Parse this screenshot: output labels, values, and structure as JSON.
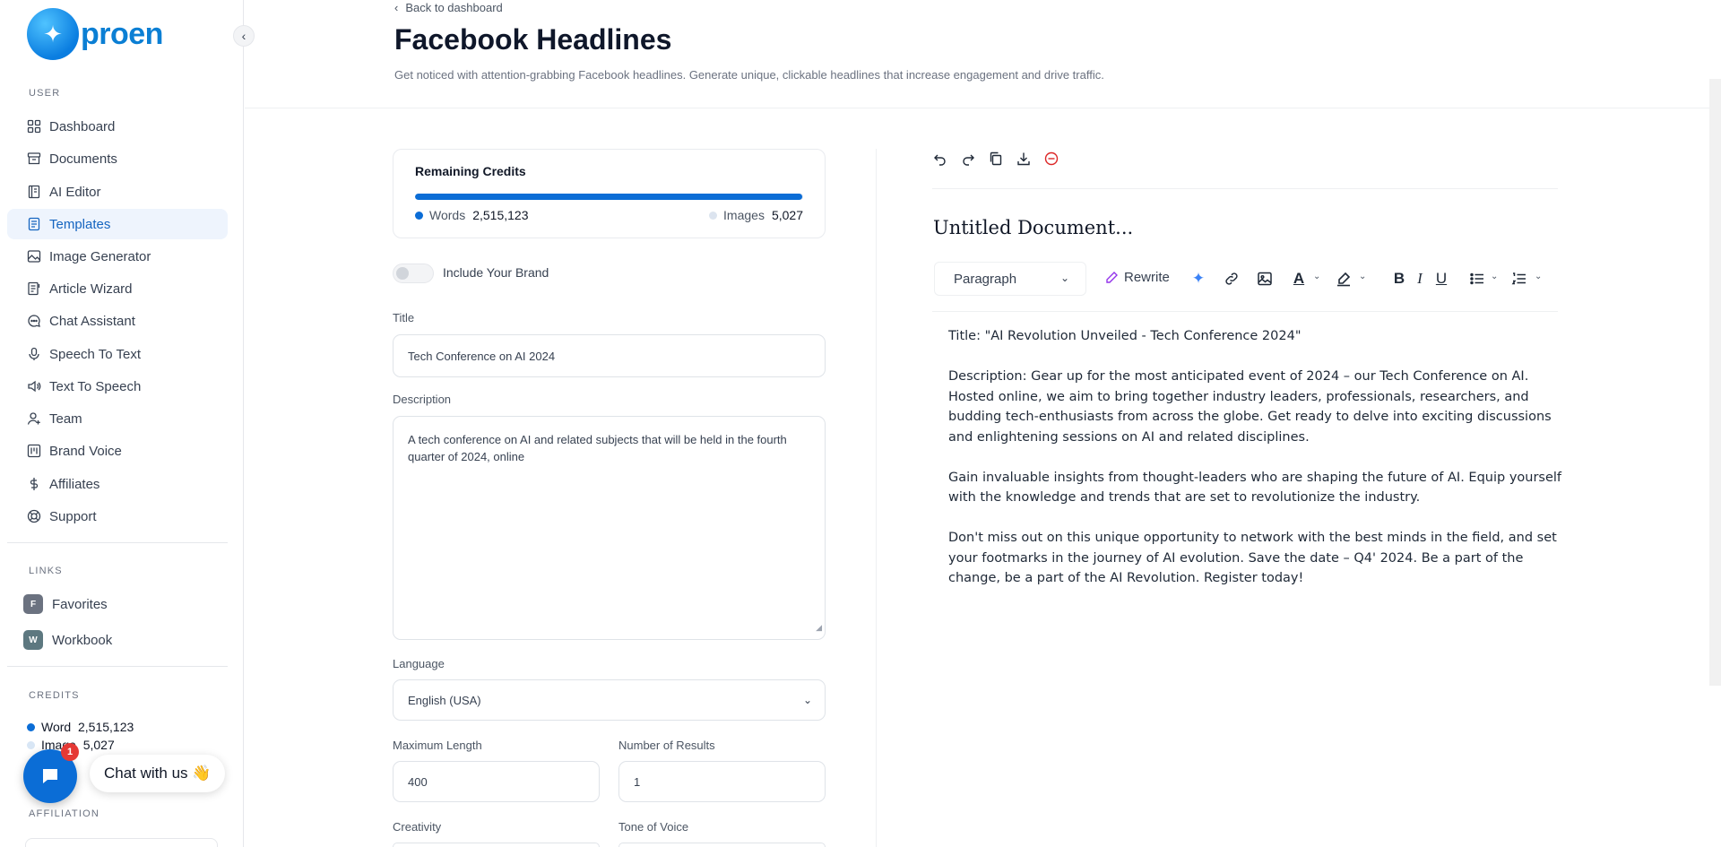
{
  "brand": {
    "name": "proen"
  },
  "sidebar": {
    "user_label": "USER",
    "items": [
      {
        "label": "Dashboard",
        "icon": "grid-icon"
      },
      {
        "label": "Documents",
        "icon": "archive-icon"
      },
      {
        "label": "AI Editor",
        "icon": "notebook-icon"
      },
      {
        "label": "Templates",
        "icon": "template-icon",
        "active": true
      },
      {
        "label": "Image Generator",
        "icon": "image-icon"
      },
      {
        "label": "Article Wizard",
        "icon": "wizard-icon"
      },
      {
        "label": "Chat Assistant",
        "icon": "chat-icon"
      },
      {
        "label": "Speech To Text",
        "icon": "mic-icon"
      },
      {
        "label": "Text To Speech",
        "icon": "speaker-icon"
      },
      {
        "label": "Team",
        "icon": "user-plus-icon"
      },
      {
        "label": "Brand Voice",
        "icon": "brand-icon"
      },
      {
        "label": "Affiliates",
        "icon": "dollar-icon"
      },
      {
        "label": "Support",
        "icon": "lifebuoy-icon"
      }
    ],
    "links_label": "LINKS",
    "links": [
      {
        "badge": "F",
        "label": "Favorites"
      },
      {
        "badge": "W",
        "label": "Workbook"
      }
    ],
    "credits_label": "CREDITS",
    "credits": [
      {
        "label": "Word",
        "value": "2,515,123",
        "color": "#0b6dd6"
      },
      {
        "label": "Image",
        "value": "5,027",
        "color": "#d8e6f5"
      }
    ],
    "affiliation_label": "AFFILIATION"
  },
  "chat_widget": {
    "label": "Chat with us 👋",
    "badge": "1"
  },
  "header": {
    "back_label": "Back to dashboard",
    "title": "Facebook Headlines",
    "description": "Get noticed with attention-grabbing Facebook headlines. Generate unique, clickable headlines that increase engagement and drive traffic."
  },
  "credits_card": {
    "title": "Remaining Credits",
    "words_label": "Words",
    "words_value": "2,515,123",
    "images_label": "Images",
    "images_value": "5,027",
    "progress_fraction": 0.998,
    "words_color": "#0b6dd6",
    "images_color": "#dce4ef"
  },
  "form": {
    "brand_toggle_label": "Include Your Brand",
    "title_label": "Title",
    "title_value": "Tech Conference on AI 2024",
    "description_label": "Description",
    "description_value": "A tech conference on AI and related subjects that will be held in the fourth quarter of 2024, online",
    "language_label": "Language",
    "language_value": "English (USA)",
    "max_length_label": "Maximum Length",
    "max_length_value": "400",
    "num_results_label": "Number of Results",
    "num_results_value": "1",
    "creativity_label": "Creativity",
    "tone_label": "Tone of Voice"
  },
  "editor": {
    "doc_title": "Untitled Document...",
    "paragraph_select": "Paragraph",
    "rewrite_label": "Rewrite",
    "content": [
      "Title: \"AI Revolution Unveiled - Tech Conference 2024\"",
      "Description: Gear up for the most anticipated event of 2024 – our Tech Conference on AI. Hosted online, we aim to bring together industry leaders, professionals, researchers, and budding tech-enthusiasts from across the globe. Get ready to delve into exciting discussions and enlightening sessions on AI and related disciplines.",
      "Gain invaluable insights from thought-leaders who are shaping the future of AI. Equip yourself with the knowledge and trends that are set to revolutionize the industry.",
      "Don't miss out on this unique opportunity to network with the best minds in the field, and set your footmarks in the journey of AI evolution. Save the date – Q4' 2024. Be a part of the change, be a part of the AI Revolution. Register today!"
    ]
  }
}
